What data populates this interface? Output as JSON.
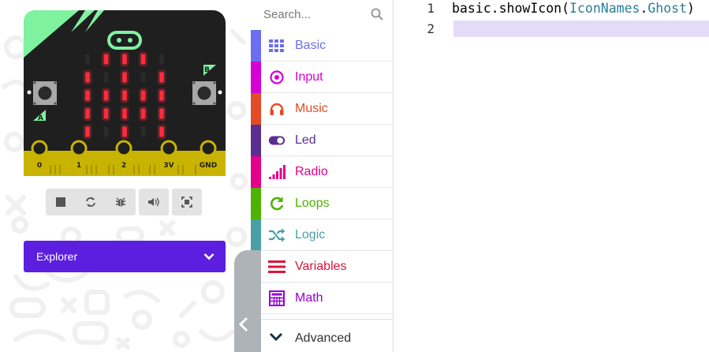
{
  "simulator": {
    "board": {
      "pins": [
        "0",
        "1",
        "2",
        "3V",
        "GND"
      ],
      "button_a_label": "A",
      "button_b_label": "B",
      "led_matrix": [
        [
          0,
          1,
          1,
          1,
          0
        ],
        [
          1,
          0,
          1,
          0,
          1
        ],
        [
          1,
          1,
          1,
          1,
          1
        ],
        [
          1,
          1,
          1,
          1,
          1
        ],
        [
          1,
          0,
          1,
          0,
          1
        ]
      ],
      "colors": {
        "board": "#1f1f1f",
        "accent": "#7ff2a0",
        "led_on": "#ff2b3d",
        "pins": "#c8b400"
      }
    },
    "toolbar": {
      "buttons": [
        "stop-icon",
        "restart-icon",
        "debug-icon",
        "mute-icon",
        "fullscreen-icon"
      ]
    },
    "explorer": {
      "label": "Explorer"
    }
  },
  "toolbox": {
    "search_placeholder": "Search...",
    "categories": [
      {
        "label": "Basic",
        "color": "#6b6ef0",
        "icon": "grid-icon"
      },
      {
        "label": "Input",
        "color": "#d400d4",
        "icon": "target-icon"
      },
      {
        "label": "Music",
        "color": "#e24b25",
        "icon": "headphones-icon"
      },
      {
        "label": "Led",
        "color": "#5c2d91",
        "icon": "toggle-icon"
      },
      {
        "label": "Radio",
        "color": "#e3008c",
        "icon": "signal-bars-icon"
      },
      {
        "label": "Loops",
        "color": "#4eb300",
        "icon": "refresh-icon"
      },
      {
        "label": "Logic",
        "color": "#4a9fa7",
        "icon": "shuffle-icon"
      },
      {
        "label": "Variables",
        "color": "#dc143c",
        "icon": "lines-icon"
      },
      {
        "label": "Math",
        "color": "#9400d3",
        "icon": "calculator-icon"
      }
    ],
    "advanced": {
      "label": "Advanced"
    }
  },
  "editor": {
    "lines": [
      {
        "number": "1",
        "code": {
          "obj": "basic",
          "method": "showIcon",
          "type": "IconNames",
          "member": "Ghost"
        }
      },
      {
        "number": "2",
        "code": null
      }
    ]
  }
}
